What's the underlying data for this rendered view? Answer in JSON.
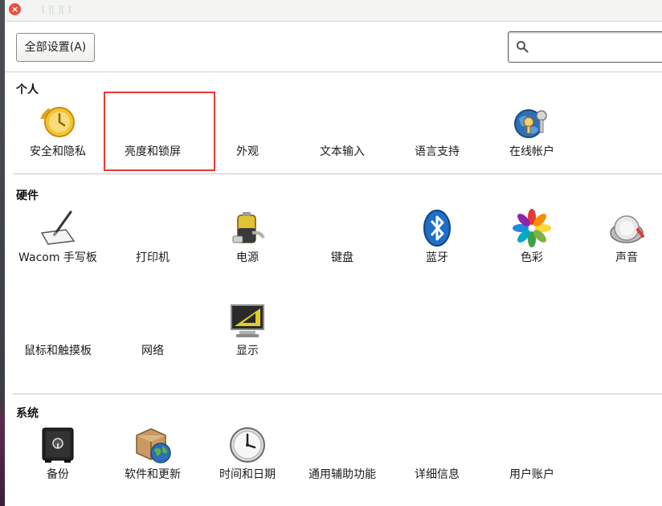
{
  "window": {
    "title": "[ ][ ][ ]"
  },
  "toolbar": {
    "all_settings_label": "全部设置(A)",
    "search_placeholder": ""
  },
  "sections": {
    "personal": {
      "title": "个人",
      "items": [
        {
          "label": "安全和隐私",
          "icon": "security-privacy-icon"
        },
        {
          "label": "亮度和锁屏",
          "icon": "brightness-lock-icon"
        },
        {
          "label": "外观",
          "icon": "appearance-icon"
        },
        {
          "label": "文本输入",
          "icon": "text-entry-icon"
        },
        {
          "label": "语言支持",
          "icon": "language-support-icon"
        },
        {
          "label": "在线帐户",
          "icon": "online-accounts-icon"
        }
      ]
    },
    "hardware": {
      "title": "硬件",
      "items": [
        {
          "label": "Wacom 手写板",
          "icon": "wacom-tablet-icon"
        },
        {
          "label": "打印机",
          "icon": "printer-icon"
        },
        {
          "label": "电源",
          "icon": "power-icon"
        },
        {
          "label": "键盘",
          "icon": "keyboard-icon"
        },
        {
          "label": "蓝牙",
          "icon": "bluetooth-icon"
        },
        {
          "label": "色彩",
          "icon": "color-icon"
        },
        {
          "label": "声音",
          "icon": "sound-icon"
        },
        {
          "label": "鼠标和触摸板",
          "icon": "mouse-touchpad-icon"
        },
        {
          "label": "网络",
          "icon": "network-icon"
        },
        {
          "label": "显示",
          "icon": "display-icon"
        }
      ]
    },
    "system": {
      "title": "系统",
      "items": [
        {
          "label": "备份",
          "icon": "backup-icon"
        },
        {
          "label": "软件和更新",
          "icon": "software-updates-icon"
        },
        {
          "label": "时间和日期",
          "icon": "time-date-icon"
        },
        {
          "label": "通用辅助功能",
          "icon": "universal-access-icon"
        },
        {
          "label": "详细信息",
          "icon": "details-icon"
        },
        {
          "label": "用户账户",
          "icon": "user-accounts-icon"
        }
      ]
    }
  },
  "colors": {
    "highlight": "#e53935",
    "close": "#e9503f"
  }
}
